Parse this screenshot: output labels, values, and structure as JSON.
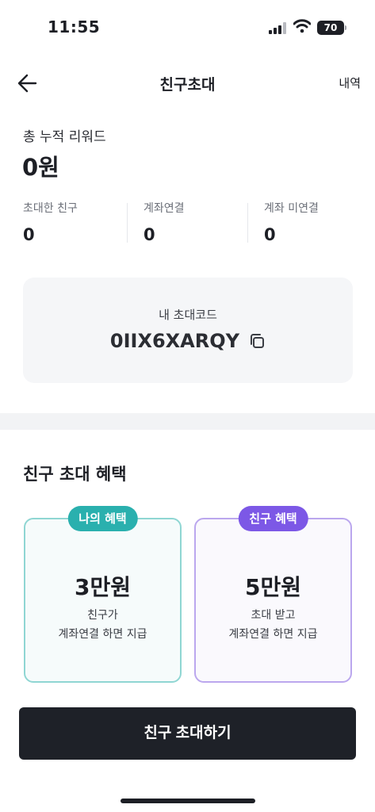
{
  "status": {
    "time": "11:55",
    "battery": "70"
  },
  "header": {
    "title": "친구초대",
    "history": "내역"
  },
  "reward": {
    "label": "총 누적 리워드",
    "value": "0원"
  },
  "stats": [
    {
      "label": "초대한 친구",
      "value": "0"
    },
    {
      "label": "계좌연결",
      "value": "0"
    },
    {
      "label": "계좌 미연결",
      "value": "0"
    }
  ],
  "invite": {
    "label": "내 초대코드",
    "code": "0IIX6XARQY"
  },
  "benefits": {
    "title": "친구 초대 혜택",
    "mine": {
      "badge": "나의 혜택",
      "amount": "3만원",
      "line1": "친구가",
      "line2": "계좌연결 하면 지급",
      "color": "#2ab0ae"
    },
    "friend": {
      "badge": "친구 혜택",
      "amount": "5만원",
      "line1": "초대 받고",
      "line2": "계좌연결 하면 지급",
      "color": "#7c58e6"
    }
  },
  "cta": {
    "label": "친구 초대하기"
  },
  "icons": [
    "back-arrow-icon",
    "copy-icon",
    "signal-icon",
    "wifi-icon",
    "battery-icon"
  ]
}
